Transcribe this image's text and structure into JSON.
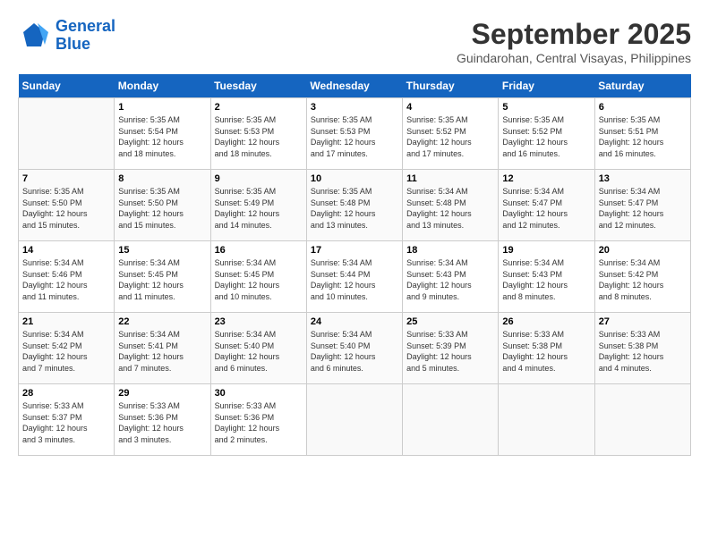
{
  "logo": {
    "line1": "General",
    "line2": "Blue"
  },
  "title": "September 2025",
  "location": "Guindarohan, Central Visayas, Philippines",
  "days_of_week": [
    "Sunday",
    "Monday",
    "Tuesday",
    "Wednesday",
    "Thursday",
    "Friday",
    "Saturday"
  ],
  "weeks": [
    [
      {
        "day": "",
        "info": ""
      },
      {
        "day": "1",
        "info": "Sunrise: 5:35 AM\nSunset: 5:54 PM\nDaylight: 12 hours\nand 18 minutes."
      },
      {
        "day": "2",
        "info": "Sunrise: 5:35 AM\nSunset: 5:53 PM\nDaylight: 12 hours\nand 18 minutes."
      },
      {
        "day": "3",
        "info": "Sunrise: 5:35 AM\nSunset: 5:53 PM\nDaylight: 12 hours\nand 17 minutes."
      },
      {
        "day": "4",
        "info": "Sunrise: 5:35 AM\nSunset: 5:52 PM\nDaylight: 12 hours\nand 17 minutes."
      },
      {
        "day": "5",
        "info": "Sunrise: 5:35 AM\nSunset: 5:52 PM\nDaylight: 12 hours\nand 16 minutes."
      },
      {
        "day": "6",
        "info": "Sunrise: 5:35 AM\nSunset: 5:51 PM\nDaylight: 12 hours\nand 16 minutes."
      }
    ],
    [
      {
        "day": "7",
        "info": "Sunrise: 5:35 AM\nSunset: 5:50 PM\nDaylight: 12 hours\nand 15 minutes."
      },
      {
        "day": "8",
        "info": "Sunrise: 5:35 AM\nSunset: 5:50 PM\nDaylight: 12 hours\nand 15 minutes."
      },
      {
        "day": "9",
        "info": "Sunrise: 5:35 AM\nSunset: 5:49 PM\nDaylight: 12 hours\nand 14 minutes."
      },
      {
        "day": "10",
        "info": "Sunrise: 5:35 AM\nSunset: 5:48 PM\nDaylight: 12 hours\nand 13 minutes."
      },
      {
        "day": "11",
        "info": "Sunrise: 5:34 AM\nSunset: 5:48 PM\nDaylight: 12 hours\nand 13 minutes."
      },
      {
        "day": "12",
        "info": "Sunrise: 5:34 AM\nSunset: 5:47 PM\nDaylight: 12 hours\nand 12 minutes."
      },
      {
        "day": "13",
        "info": "Sunrise: 5:34 AM\nSunset: 5:47 PM\nDaylight: 12 hours\nand 12 minutes."
      }
    ],
    [
      {
        "day": "14",
        "info": "Sunrise: 5:34 AM\nSunset: 5:46 PM\nDaylight: 12 hours\nand 11 minutes."
      },
      {
        "day": "15",
        "info": "Sunrise: 5:34 AM\nSunset: 5:45 PM\nDaylight: 12 hours\nand 11 minutes."
      },
      {
        "day": "16",
        "info": "Sunrise: 5:34 AM\nSunset: 5:45 PM\nDaylight: 12 hours\nand 10 minutes."
      },
      {
        "day": "17",
        "info": "Sunrise: 5:34 AM\nSunset: 5:44 PM\nDaylight: 12 hours\nand 10 minutes."
      },
      {
        "day": "18",
        "info": "Sunrise: 5:34 AM\nSunset: 5:43 PM\nDaylight: 12 hours\nand 9 minutes."
      },
      {
        "day": "19",
        "info": "Sunrise: 5:34 AM\nSunset: 5:43 PM\nDaylight: 12 hours\nand 8 minutes."
      },
      {
        "day": "20",
        "info": "Sunrise: 5:34 AM\nSunset: 5:42 PM\nDaylight: 12 hours\nand 8 minutes."
      }
    ],
    [
      {
        "day": "21",
        "info": "Sunrise: 5:34 AM\nSunset: 5:42 PM\nDaylight: 12 hours\nand 7 minutes."
      },
      {
        "day": "22",
        "info": "Sunrise: 5:34 AM\nSunset: 5:41 PM\nDaylight: 12 hours\nand 7 minutes."
      },
      {
        "day": "23",
        "info": "Sunrise: 5:34 AM\nSunset: 5:40 PM\nDaylight: 12 hours\nand 6 minutes."
      },
      {
        "day": "24",
        "info": "Sunrise: 5:34 AM\nSunset: 5:40 PM\nDaylight: 12 hours\nand 6 minutes."
      },
      {
        "day": "25",
        "info": "Sunrise: 5:33 AM\nSunset: 5:39 PM\nDaylight: 12 hours\nand 5 minutes."
      },
      {
        "day": "26",
        "info": "Sunrise: 5:33 AM\nSunset: 5:38 PM\nDaylight: 12 hours\nand 4 minutes."
      },
      {
        "day": "27",
        "info": "Sunrise: 5:33 AM\nSunset: 5:38 PM\nDaylight: 12 hours\nand 4 minutes."
      }
    ],
    [
      {
        "day": "28",
        "info": "Sunrise: 5:33 AM\nSunset: 5:37 PM\nDaylight: 12 hours\nand 3 minutes."
      },
      {
        "day": "29",
        "info": "Sunrise: 5:33 AM\nSunset: 5:36 PM\nDaylight: 12 hours\nand 3 minutes."
      },
      {
        "day": "30",
        "info": "Sunrise: 5:33 AM\nSunset: 5:36 PM\nDaylight: 12 hours\nand 2 minutes."
      },
      {
        "day": "",
        "info": ""
      },
      {
        "day": "",
        "info": ""
      },
      {
        "day": "",
        "info": ""
      },
      {
        "day": "",
        "info": ""
      }
    ]
  ]
}
